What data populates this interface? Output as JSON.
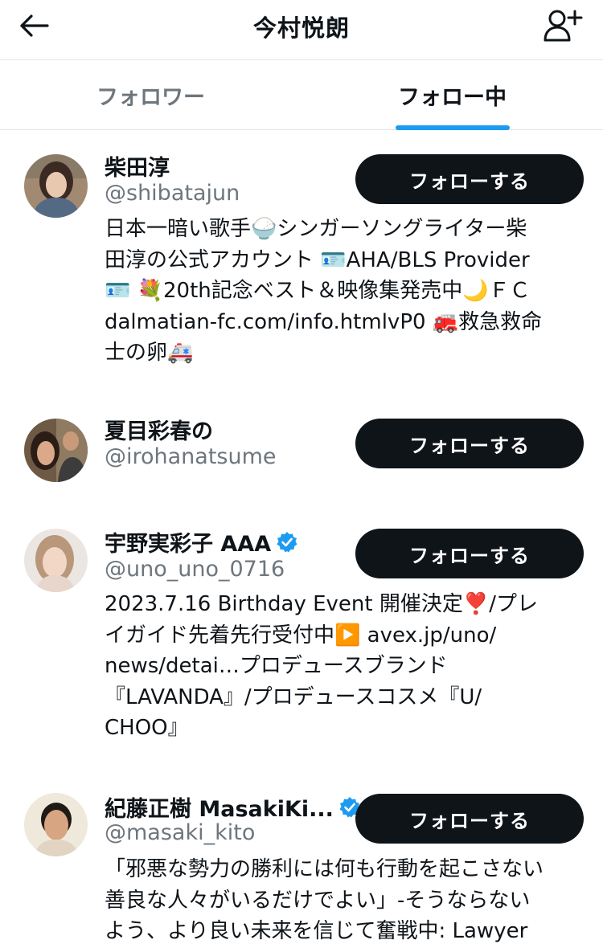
{
  "header": {
    "title": "今村悦朗"
  },
  "tabs": {
    "followers": "フォロワー",
    "following": "フォロー中"
  },
  "follow_label": "フォローする",
  "colors": {
    "accent": "#1d9bf0",
    "button": "#0f1419",
    "secondary_text": "#6e767d"
  },
  "users": [
    {
      "name": "柴田淳",
      "handle": "@shibatajun",
      "verified": false,
      "bio_lines": [
        "日本一暗い歌手🍚シンガーソングライター柴",
        "田淳の公式アカウント 🪪AHA/BLS Provider",
        "🪪 💐20th記念ベスト＆映像集発売中🌙ＦＣ",
        "dalmatian-fc.com/info.htmlvP0 🚒救急救命",
        "士の卵🚑"
      ]
    },
    {
      "name": "夏目彩春の",
      "handle": "@irohanatsume",
      "verified": false,
      "bio_lines": []
    },
    {
      "name": "宇野実彩子 AAA",
      "handle": "@uno_uno_0716",
      "verified": true,
      "bio_lines": [
        "2023.7.16 Birthday Event 開催決定❣️/プレ",
        "イガイド先着先行受付中▶️ avex.jp/uno/",
        "news/detai…プロデュースブランド",
        "『LAVANDA』/プロデュースコスメ『U/",
        "CHOO』"
      ]
    },
    {
      "name": "紀藤正樹 MasakiKi...",
      "handle": "@masaki_kito",
      "verified": true,
      "bio_lines": [
        "「邪悪な勢力の勝利には何も行動を起こさない",
        "善良な人々がいるだけでよい」-そうならない",
        "よう、より良い未来を信じて奮戦中: Lawyer"
      ]
    }
  ]
}
